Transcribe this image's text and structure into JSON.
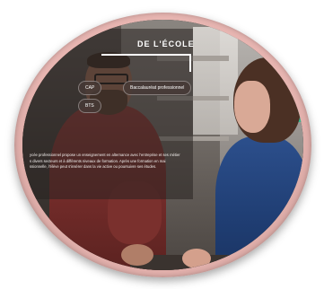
{
  "section": {
    "heading": "DE L'ÉCOLE"
  },
  "filters": [
    {
      "label": "CAP"
    },
    {
      "label": "Baccalauréat professionnel"
    },
    {
      "label": "BTS"
    }
  ],
  "description": {
    "lines": [
      "ycée professionnel propose un enseignement en alternance avec l'entreprise et ses métiers,",
      "s divers secteurs et à différents niveaux de formation. Après une formation en mai",
      "ssionnelle, l'élève peut s'insérer dans la vie active ou poursuivre ses études."
    ]
  },
  "colors": {
    "frame": "#e7b5b1",
    "accent": "#3bb58f"
  }
}
